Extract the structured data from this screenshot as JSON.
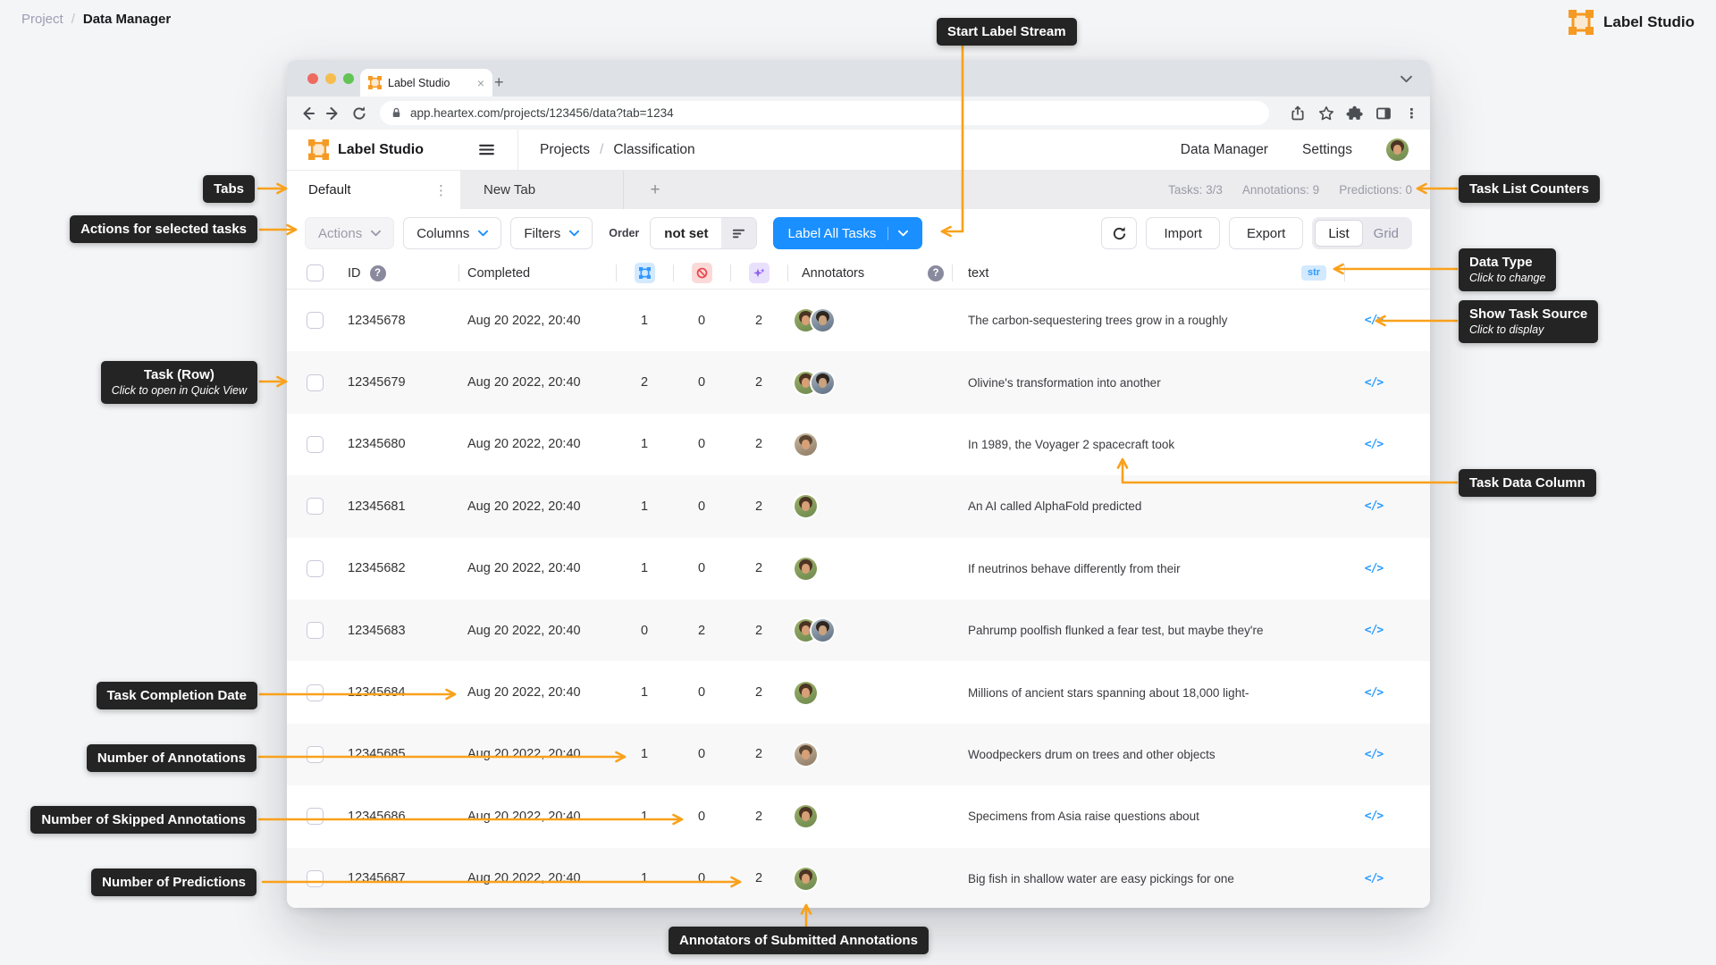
{
  "page": {
    "breadcrumb": {
      "project": "Project",
      "separator": "/",
      "current": "Data Manager"
    },
    "brand": {
      "name": "Label Studio"
    }
  },
  "browser": {
    "tab_title": "Label Studio",
    "url": "app.heartex.com/projects/123456/data?tab=1234"
  },
  "app": {
    "header": {
      "brand": "Label Studio",
      "nav_project": "Projects",
      "nav_separator": "/",
      "nav_page": "Classification",
      "menu_data_manager": "Data Manager",
      "menu_settings": "Settings"
    },
    "tabs": {
      "active": "Default",
      "inactive": "New Tab",
      "add": "+"
    },
    "counters": {
      "tasks": "Tasks: 3/3",
      "annotations": "Annotations: 9",
      "predictions": "Predictions: 0"
    },
    "toolbar": {
      "actions": "Actions",
      "columns": "Columns",
      "filters": "Filters",
      "order_label": "Order",
      "order_value": "not set",
      "label_all_tasks": "Label All Tasks",
      "import": "Import",
      "export": "Export",
      "view_list": "List",
      "view_grid": "Grid"
    },
    "table": {
      "headers": {
        "id": "ID",
        "completed": "Completed",
        "annotators": "Annotators",
        "text": "text",
        "data_type_badge": "str"
      },
      "rows": [
        {
          "id": "12345678",
          "completed": "Aug 20 2022, 20:40",
          "annotations": "1",
          "skipped": "0",
          "predictions": "2",
          "annotators": [
            "woman",
            "man"
          ],
          "text": "The carbon-sequestering trees grow in a roughly"
        },
        {
          "id": "12345679",
          "completed": "Aug 20 2022, 20:40",
          "annotations": "2",
          "skipped": "0",
          "predictions": "2",
          "annotators": [
            "woman",
            "man"
          ],
          "text": "Olivine's transformation into another"
        },
        {
          "id": "12345680",
          "completed": "Aug 20 2022, 20:40",
          "annotations": "1",
          "skipped": "0",
          "predictions": "2",
          "annotators": [
            "man2"
          ],
          "text": "In 1989, the Voyager 2 spacecraft took"
        },
        {
          "id": "12345681",
          "completed": "Aug 20 2022, 20:40",
          "annotations": "1",
          "skipped": "0",
          "predictions": "2",
          "annotators": [
            "woman"
          ],
          "text": "An AI called AlphaFold predicted"
        },
        {
          "id": "12345682",
          "completed": "Aug 20 2022, 20:40",
          "annotations": "1",
          "skipped": "0",
          "predictions": "2",
          "annotators": [
            "woman"
          ],
          "text": "If neutrinos behave differently from their"
        },
        {
          "id": "12345683",
          "completed": "Aug 20 2022, 20:40",
          "annotations": "0",
          "skipped": "2",
          "predictions": "2",
          "annotators": [
            "woman",
            "man"
          ],
          "text": "Pahrump poolfish flunked a fear test, but maybe they're"
        },
        {
          "id": "12345684",
          "completed": "Aug 20 2022, 20:40",
          "annotations": "1",
          "skipped": "0",
          "predictions": "2",
          "annotators": [
            "woman"
          ],
          "text": "Millions of ancient stars spanning about 18,000 light-"
        },
        {
          "id": "12345685",
          "completed": "Aug 20 2022, 20:40",
          "annotations": "1",
          "skipped": "0",
          "predictions": "2",
          "annotators": [
            "man2"
          ],
          "text": "Woodpeckers drum on trees and other objects"
        },
        {
          "id": "12345686",
          "completed": "Aug 20 2022, 20:40",
          "annotations": "1",
          "skipped": "0",
          "predictions": "2",
          "annotators": [
            "woman"
          ],
          "text": "Specimens from Asia raise questions about"
        },
        {
          "id": "12345687",
          "completed": "Aug 20 2022, 20:40",
          "annotations": "1",
          "skipped": "0",
          "predictions": "2",
          "annotators": [
            "woman"
          ],
          "text": "Big fish in shallow water are easy pickings for one"
        }
      ]
    }
  },
  "callouts": {
    "start_label_stream": {
      "label": "Start Label Stream"
    },
    "tabs": {
      "label": "Tabs"
    },
    "actions": {
      "label": "Actions for selected tasks"
    },
    "task_list_counters": {
      "label": "Task List Counters"
    },
    "data_type": {
      "label": "Data Type",
      "sublabel": "Click to change"
    },
    "show_task_source": {
      "label": "Show Task Source",
      "sublabel": "Click to display"
    },
    "task_row": {
      "label": "Task (Row)",
      "sublabel": "Click to open in Quick View"
    },
    "task_data_column": {
      "label": "Task Data Column"
    },
    "task_completion_date": {
      "label": "Task Completion Date"
    },
    "number_of_annotations": {
      "label": "Number of Annotations"
    },
    "number_of_skipped_annotations": {
      "label": "Number of Skipped Annotations"
    },
    "number_of_predictions": {
      "label": "Number of Predictions"
    },
    "annotators_of_submitted": {
      "label": "Annotators of Submitted Annotations"
    }
  },
  "icons": {
    "help": "?",
    "close": "×",
    "kebab": "⋮",
    "plus": "+",
    "source": "</>"
  },
  "colors": {
    "accent_orange": "#F9A11B",
    "brand_orange": "#F59A23",
    "primary_blue": "#1A8FFF",
    "badge_blue": "#2B9CFF",
    "annotations_blue": "#2F97FF",
    "skipped_red": "#E5484D",
    "predictions_purple": "#8F62F2",
    "callout_bg": "#242424"
  }
}
